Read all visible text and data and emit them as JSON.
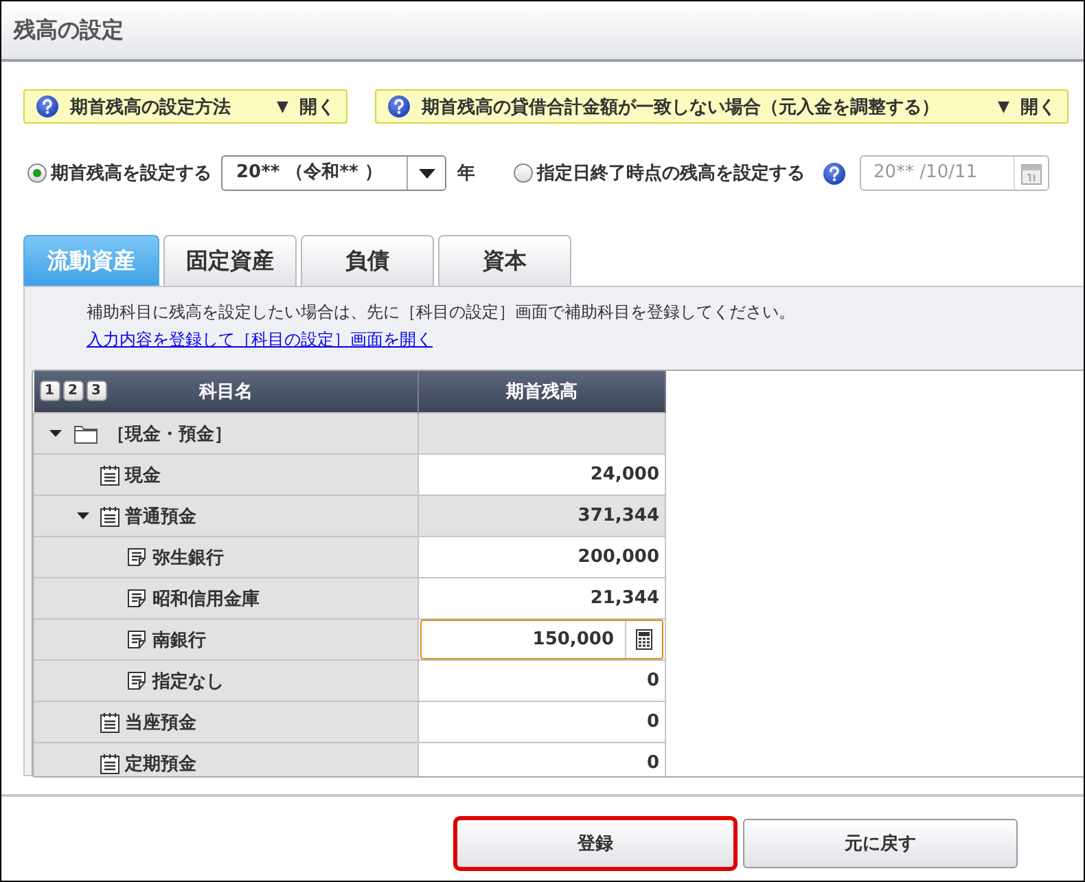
{
  "title": "残高の設定",
  "help_bars": [
    {
      "label": "期首残高の設定方法",
      "toggle": "▼",
      "action": "開く"
    },
    {
      "label": "期首残高の貸借合計金額が一致しない場合（元入金を調整する）",
      "toggle": "▼",
      "action": "開く"
    }
  ],
  "balance_modes": [
    {
      "kind": "year",
      "label": "期首残高を設定する",
      "selected": true,
      "select_value": "20** （令和** ）",
      "unit": "年"
    },
    {
      "kind": "date",
      "label": "指定日終了時点の残高を設定する",
      "selected": false,
      "date_value": "20** /10/11",
      "disabled": true
    }
  ],
  "tabs": [
    {
      "label": "流動資産",
      "selected": true
    },
    {
      "label": "固定資産",
      "selected": false
    },
    {
      "label": "負債",
      "selected": false
    },
    {
      "label": "資本",
      "selected": false
    }
  ],
  "notice": "補助科目に残高を設定したい場合は、先に［科目の設定］画面で補助科目を登録してください。",
  "link": "入力内容を登録して［科目の設定］画面を開く",
  "table": {
    "levels": [
      "1",
      "2",
      "3"
    ],
    "columns": [
      "科目名",
      "期首残高"
    ],
    "rows": [
      {
        "kind": "folder",
        "name": "［現金・預金］",
        "expanded": true,
        "children": [
          {
            "kind": "account",
            "name": "現金",
            "value": "24,000",
            "editable": true,
            "focused": false
          },
          {
            "kind": "account",
            "name": "普通預金",
            "value": "371,344",
            "editable": false,
            "focused": false,
            "expanded": true,
            "children": [
              {
                "kind": "subaccount",
                "name": "弥生銀行",
                "value": "200,000",
                "editable": true,
                "focused": false
              },
              {
                "kind": "subaccount",
                "name": "昭和信用金庫",
                "value": "21,344",
                "editable": true,
                "focused": false
              },
              {
                "kind": "subaccount",
                "name": "南銀行",
                "value": "150,000",
                "editable": true,
                "focused": true
              },
              {
                "kind": "subaccount",
                "name": "指定なし",
                "value": "0",
                "editable": true,
                "focused": false
              }
            ]
          },
          {
            "kind": "account",
            "name": "当座預金",
            "value": "0",
            "editable": true,
            "focused": false
          },
          {
            "kind": "account",
            "name": "定期預金",
            "value": "0",
            "editable": true,
            "focused": false
          }
        ]
      }
    ]
  },
  "buttons": [
    {
      "label": "登録",
      "focused": true
    },
    {
      "label": "元に戻す",
      "focused": false
    }
  ]
}
